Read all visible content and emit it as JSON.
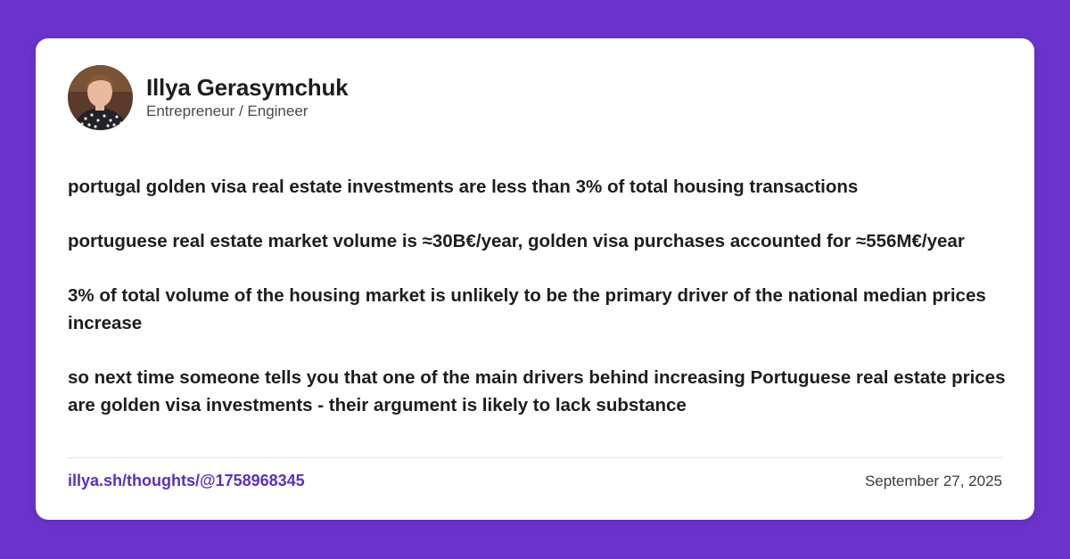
{
  "colors": {
    "background": "#6a34cc",
    "card": "#ffffff",
    "text": "#1d1d1f",
    "link": "#5b2ec6"
  },
  "author": {
    "name": "Illya Gerasymchuk",
    "role": "Entrepreneur / Engineer",
    "avatar_icon": "profile-photo"
  },
  "post": {
    "paragraphs": [
      "portugal golden visa real estate investments are less than 3% of total housing transactions",
      "portuguese real estate market volume is ≈30B€/year, golden visa purchases accounted for ≈556M€/year",
      "3% of total volume of the housing market is unlikely to be the primary driver of the national median prices increase",
      "so next time someone tells you that one of the main drivers behind increasing Portuguese real estate prices are golden visa investments - their argument is likely to lack substance"
    ]
  },
  "footer": {
    "permalink": "illya.sh/thoughts/@1758968345",
    "date": "September 27, 2025"
  }
}
